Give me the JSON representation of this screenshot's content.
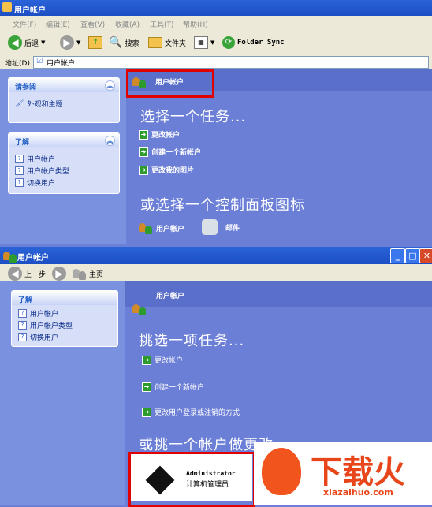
{
  "top_window": {
    "title": "用户帐户",
    "menu": [
      "文件(F)",
      "编辑(E)",
      "查看(V)",
      "收藏(A)",
      "工具(T)",
      "帮助(H)"
    ],
    "toolbar": {
      "back": "后退",
      "search": "搜索",
      "folders": "文件夹",
      "folder_sync": "Folder Sync"
    },
    "address_label": "地址(D)",
    "address_value": "用户帐户",
    "see_also": {
      "title": "请参阅",
      "items": [
        "外观和主题"
      ]
    },
    "learn_about": {
      "title": "了解",
      "items": [
        "用户帐户",
        "用户帐户类型",
        "切换用户"
      ]
    },
    "header_title": "用户帐户",
    "pick_task": "选择一个任务...",
    "tasks": [
      "更改帐户",
      "创建一个新帐户",
      "更改我的图片"
    ],
    "or_pick": "或选择一个控制面板图标",
    "icons": [
      "用户帐户",
      "邮件"
    ]
  },
  "second_window": {
    "title": "用户帐户",
    "nav": {
      "back": "上一步",
      "home": "主页"
    },
    "learn_about": {
      "title": "了解",
      "items": [
        "用户帐户",
        "用户帐户类型",
        "切换用户"
      ]
    },
    "header_title": "用户帐户",
    "pick_task": "挑选一项任务...",
    "tasks": [
      "更改帐户",
      "创建一个新帐户",
      "更改用户登录或注销的方式"
    ],
    "or_pick": "或挑一个帐户做更改",
    "account": {
      "name": "Administrator",
      "role": "计算机管理员"
    }
  },
  "watermark": {
    "brand": "下载火",
    "url": "xiazaihuo.com"
  }
}
